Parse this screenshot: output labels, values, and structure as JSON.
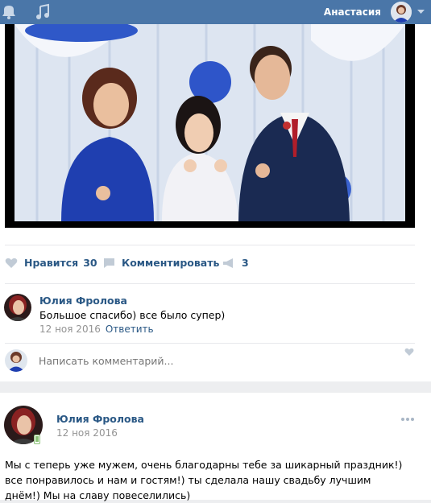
{
  "topbar": {
    "user_name": "Анастасия",
    "icons": [
      "bell-icon",
      "music-icon",
      "caret-down-icon"
    ],
    "color": "#4a76a8"
  },
  "post_photo": {
    "description_icon": "wedding-photo"
  },
  "actions": {
    "like_label": "Нравится",
    "like_count": "30",
    "comment_label": "Комментировать",
    "share_count": "3"
  },
  "comment": {
    "author": "Юлия Фролова",
    "text": "Большое спасибо) все было супер)",
    "date": "12 ноя 2016",
    "reply_label": "Ответить"
  },
  "write": {
    "placeholder": "Написать комментарий..."
  },
  "post": {
    "author": "Юлия Фролова",
    "date": "12 ноя 2016",
    "text": "Мы с теперь уже мужем, очень благодарны тебе за шикарный праздник!) все понравилось и нам и гостям!) ты сделала нашу свадьбу лучшим днём!) Мы на славу повеселились)"
  },
  "colors": {
    "link": "#2a5885",
    "meta": "#939393",
    "background": "#edeef0"
  }
}
